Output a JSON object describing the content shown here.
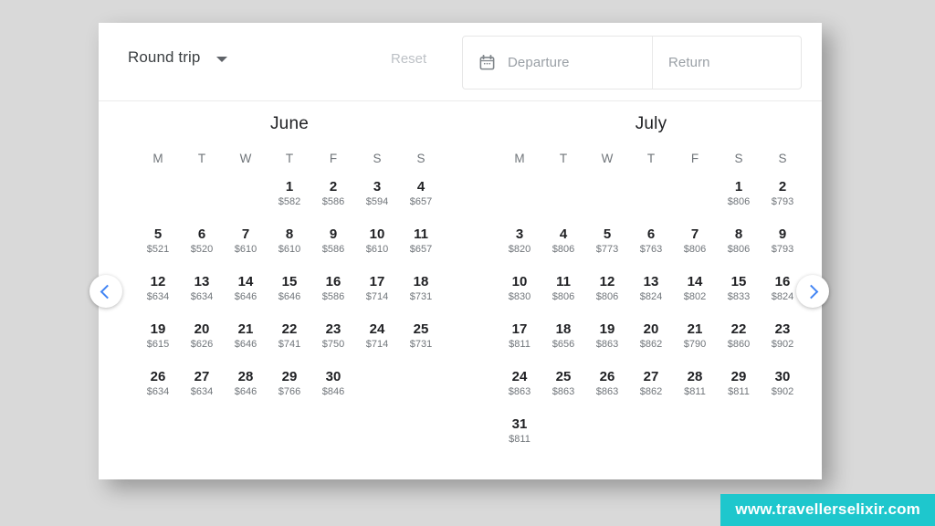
{
  "header": {
    "trip_type": "Round trip",
    "trip_type_icon": "chevron-down-icon",
    "reset_label": "Reset",
    "calendar_icon": "calendar-icon",
    "departure_placeholder": "Departure",
    "return_placeholder": "Return"
  },
  "nav": {
    "prev_icon": "chevron-left-icon",
    "next_icon": "chevron-right-icon"
  },
  "weekdays": [
    "M",
    "T",
    "W",
    "T",
    "F",
    "S",
    "S"
  ],
  "months": [
    {
      "name": "June",
      "start_weekday_index": 3,
      "days": [
        {
          "day": "1",
          "price": "$582"
        },
        {
          "day": "2",
          "price": "$586"
        },
        {
          "day": "3",
          "price": "$594"
        },
        {
          "day": "4",
          "price": "$657"
        },
        {
          "day": "5",
          "price": "$521"
        },
        {
          "day": "6",
          "price": "$520"
        },
        {
          "day": "7",
          "price": "$610"
        },
        {
          "day": "8",
          "price": "$610"
        },
        {
          "day": "9",
          "price": "$586"
        },
        {
          "day": "10",
          "price": "$610"
        },
        {
          "day": "11",
          "price": "$657"
        },
        {
          "day": "12",
          "price": "$634"
        },
        {
          "day": "13",
          "price": "$634"
        },
        {
          "day": "14",
          "price": "$646"
        },
        {
          "day": "15",
          "price": "$646"
        },
        {
          "day": "16",
          "price": "$586"
        },
        {
          "day": "17",
          "price": "$714"
        },
        {
          "day": "18",
          "price": "$731"
        },
        {
          "day": "19",
          "price": "$615"
        },
        {
          "day": "20",
          "price": "$626"
        },
        {
          "day": "21",
          "price": "$646"
        },
        {
          "day": "22",
          "price": "$741"
        },
        {
          "day": "23",
          "price": "$750"
        },
        {
          "day": "24",
          "price": "$714"
        },
        {
          "day": "25",
          "price": "$731"
        },
        {
          "day": "26",
          "price": "$634"
        },
        {
          "day": "27",
          "price": "$634"
        },
        {
          "day": "28",
          "price": "$646"
        },
        {
          "day": "29",
          "price": "$766"
        },
        {
          "day": "30",
          "price": "$846"
        }
      ]
    },
    {
      "name": "July",
      "start_weekday_index": 5,
      "days": [
        {
          "day": "1",
          "price": "$806"
        },
        {
          "day": "2",
          "price": "$793"
        },
        {
          "day": "3",
          "price": "$820"
        },
        {
          "day": "4",
          "price": "$806"
        },
        {
          "day": "5",
          "price": "$773"
        },
        {
          "day": "6",
          "price": "$763"
        },
        {
          "day": "7",
          "price": "$806"
        },
        {
          "day": "8",
          "price": "$806"
        },
        {
          "day": "9",
          "price": "$793"
        },
        {
          "day": "10",
          "price": "$830"
        },
        {
          "day": "11",
          "price": "$806"
        },
        {
          "day": "12",
          "price": "$806"
        },
        {
          "day": "13",
          "price": "$824"
        },
        {
          "day": "14",
          "price": "$802"
        },
        {
          "day": "15",
          "price": "$833"
        },
        {
          "day": "16",
          "price": "$824"
        },
        {
          "day": "17",
          "price": "$811"
        },
        {
          "day": "18",
          "price": "$656"
        },
        {
          "day": "19",
          "price": "$863"
        },
        {
          "day": "20",
          "price": "$862"
        },
        {
          "day": "21",
          "price": "$790"
        },
        {
          "day": "22",
          "price": "$860"
        },
        {
          "day": "23",
          "price": "$902"
        },
        {
          "day": "24",
          "price": "$863"
        },
        {
          "day": "25",
          "price": "$863"
        },
        {
          "day": "26",
          "price": "$863"
        },
        {
          "day": "27",
          "price": "$862"
        },
        {
          "day": "28",
          "price": "$811"
        },
        {
          "day": "29",
          "price": "$811"
        },
        {
          "day": "30",
          "price": "$902"
        },
        {
          "day": "31",
          "price": "$811"
        }
      ]
    }
  ],
  "watermark": {
    "text": "www.travellerselixir.com",
    "background": "#1ec7cd"
  }
}
